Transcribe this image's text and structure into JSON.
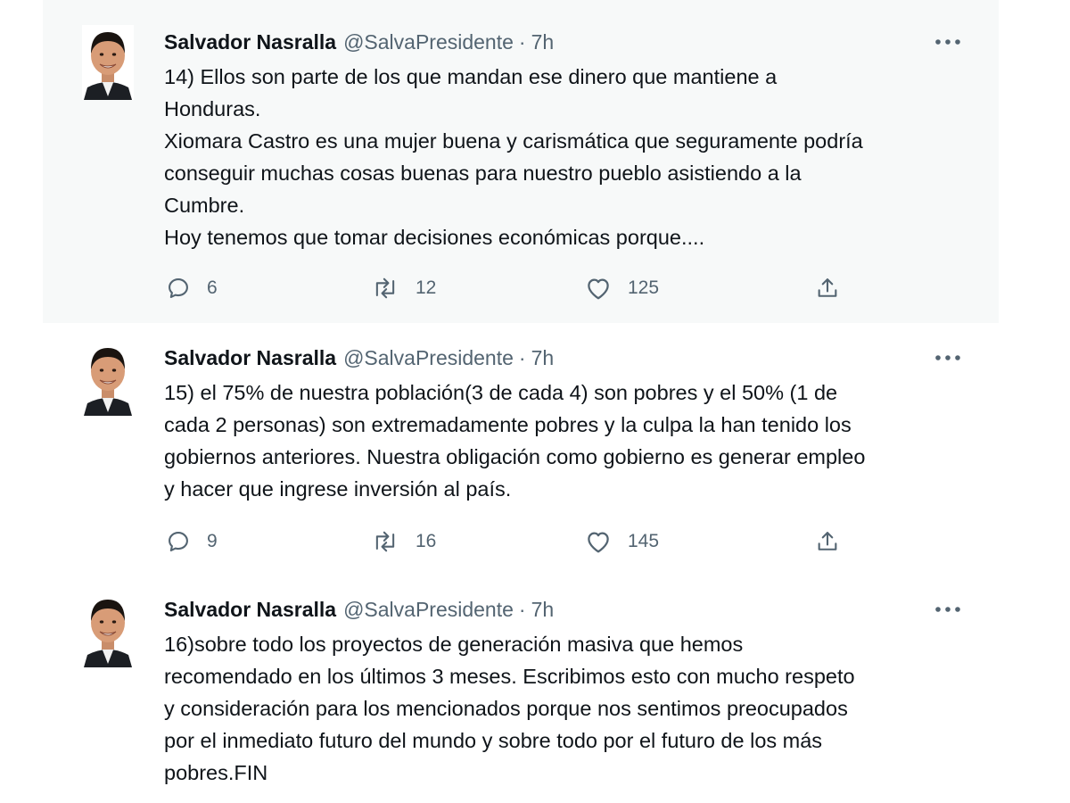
{
  "thread": {
    "tweets": [
      {
        "author": {
          "name": "Salvador Nasralla",
          "handle": "@SalvaPresidente",
          "separator": "·",
          "time": "7h"
        },
        "lines": [
          "14) Ellos son parte de los que mandan ese dinero que mantiene a",
          "Honduras.",
          "Xiomara Castro es una mujer buena y carismática que seguramente podría",
          "conseguir muchas cosas buenas para nuestro pueblo asistiendo a la",
          "Cumbre.",
          "Hoy tenemos que tomar decisiones económicas porque...."
        ],
        "actions": {
          "replies": "6",
          "retweets": "12",
          "likes": "125"
        }
      },
      {
        "author": {
          "name": "Salvador Nasralla",
          "handle": "@SalvaPresidente",
          "separator": "·",
          "time": "7h"
        },
        "lines": [
          "15) el 75% de nuestra población(3 de cada 4) son pobres y el 50% (1 de",
          "cada 2 personas) son extremadamente pobres y la culpa la han tenido los",
          "gobiernos anteriores. Nuestra obligación como gobierno es generar empleo",
          "y hacer que ingrese inversión al país."
        ],
        "actions": {
          "replies": "9",
          "retweets": "16",
          "likes": "145"
        }
      },
      {
        "author": {
          "name": "Salvador Nasralla",
          "handle": "@SalvaPresidente",
          "separator": "·",
          "time": "7h"
        },
        "lines": [
          "16)sobre todo los proyectos de generación masiva que hemos",
          "recomendado en los últimos 3 meses. Escribimos esto con mucho respeto",
          "y consideración para los mencionados porque nos sentimos preocupados",
          "por el inmediato futuro del mundo y sobre todo por el futuro de los más",
          "pobres.FIN"
        ]
      }
    ]
  },
  "icons": {
    "reply": "speech-bubble-outline",
    "retweet": "two-arrows-loop",
    "like": "heart-outline",
    "share": "upload-arrow-tray",
    "more": "three-dots-horizontal"
  },
  "colors": {
    "text_primary": "#0f1419",
    "text_secondary": "#536471",
    "thread_line": "#cfd9de",
    "highlight_bg": "#f7f9f9"
  }
}
